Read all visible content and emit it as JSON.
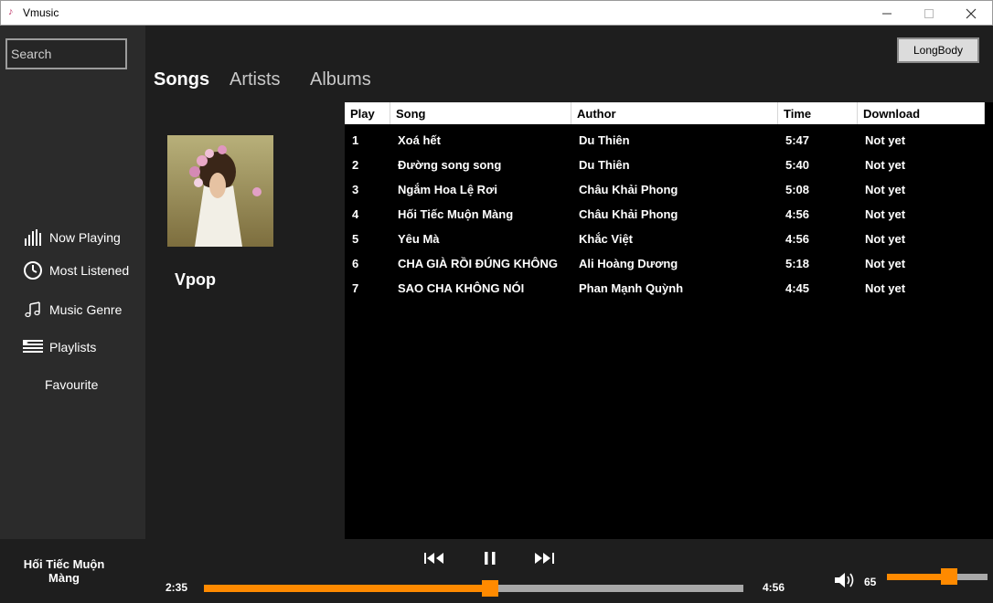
{
  "window": {
    "title": "Vmusic"
  },
  "sidebar": {
    "search_placeholder": "Search",
    "items": [
      {
        "label": "Now Playing",
        "icon": "bars-icon"
      },
      {
        "label": "Most Listened",
        "icon": "clock-icon"
      },
      {
        "label": "Music Genre",
        "icon": "music-note-icon"
      },
      {
        "label": "Playlists",
        "icon": "playlist-icon"
      },
      {
        "label": "Favourite",
        "icon": ""
      }
    ]
  },
  "header": {
    "user_button": "LongBody"
  },
  "tabs": [
    {
      "label": "Songs",
      "active": true
    },
    {
      "label": "Artists",
      "active": false
    },
    {
      "label": "Albums",
      "active": false
    }
  ],
  "genre": {
    "name": "Vpop"
  },
  "table": {
    "columns": [
      "Play",
      "Song",
      "Author",
      "Time",
      "Download"
    ],
    "rows": [
      [
        "1",
        "Xoá hết",
        "Du Thiên",
        "5:47",
        "Not yet"
      ],
      [
        "2",
        "Đường song song",
        "Du Thiên",
        "5:40",
        "Not yet"
      ],
      [
        "3",
        "Ngắm Hoa Lệ Rơi",
        "Châu Khải Phong",
        "5:08",
        "Not yet"
      ],
      [
        "4",
        "Hối Tiếc Muộn Màng",
        "Châu Khải Phong",
        "4:56",
        "Not yet"
      ],
      [
        "5",
        "Yêu Mà",
        "Khắc Việt",
        "4:56",
        "Not yet"
      ],
      [
        "6",
        "CHA GIÀ RỒI ĐÚNG KHÔNG",
        "Ali Hoàng Dương",
        "5:18",
        "Not yet"
      ],
      [
        "7",
        "SAO CHA KHÔNG NÓI",
        "Phan Mạnh Quỳnh",
        "4:45",
        "Not yet"
      ]
    ]
  },
  "player": {
    "now_playing": "Hối Tiếc Muộn Màng",
    "elapsed": "2:35",
    "duration": "4:56",
    "progress_fraction": 0.53,
    "volume": "65",
    "volume_fraction": 0.62,
    "accent_color": "#ff8a00"
  }
}
